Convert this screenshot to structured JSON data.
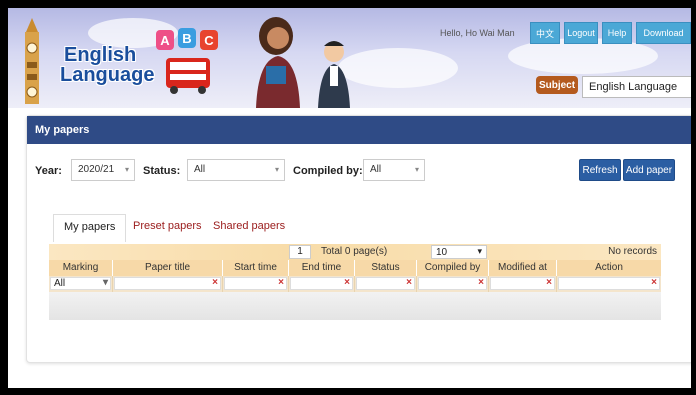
{
  "header": {
    "logo_line1": "English",
    "logo_line2": "Language",
    "abc_letters": [
      "A",
      "B",
      "C"
    ],
    "greeting": "Hello, Ho Wai Man",
    "buttons": [
      "中文",
      "Logout",
      "Help",
      "Download"
    ],
    "subject_label": "Subject",
    "subject_value": "English Language"
  },
  "panel": {
    "title": "My papers",
    "filters": {
      "year_label": "Year:",
      "year_value": "2020/21",
      "status_label": "Status:",
      "status_value": "All",
      "compiled_label": "Compiled by:",
      "compiled_value": "All"
    },
    "refresh_label": "Refresh",
    "add_label": "Add paper",
    "tabs": [
      "My papers",
      "Preset papers",
      "Shared papers"
    ],
    "pager": {
      "page": "1",
      "total": "Total 0 page(s)",
      "page_size": "10",
      "records": "No records"
    },
    "columns": [
      "Marking",
      "Paper title",
      "Start time",
      "End time",
      "Status",
      "Compiled by",
      "Modified at",
      "Action"
    ],
    "marking_filter": "All"
  },
  "colors": {
    "panel_header": "#2f4b86",
    "top_buttons": "#4ba8d6",
    "subject_badge": "#b45a1e",
    "tab_link": "#9a1b1b",
    "grid_header": "#f7d9a8"
  }
}
